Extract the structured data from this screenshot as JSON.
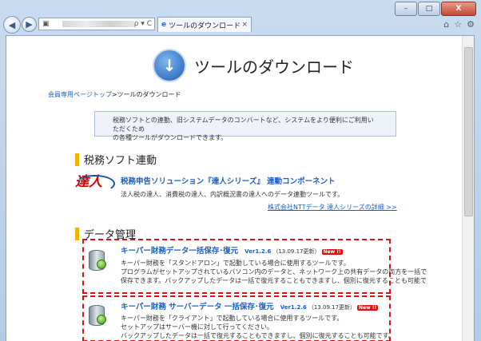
{
  "browser": {
    "tab_title": "ツールのダウンロード",
    "tab_close": "×",
    "address_icons": "ρ ▾ C",
    "window_buttons": [
      "–",
      "□",
      "X"
    ],
    "tool_icons": [
      "⌂",
      "☆",
      "⚙"
    ]
  },
  "page": {
    "title": "ツールのダウンロード",
    "breadcrumb_link": "会員専用ページトップ",
    "breadcrumb_sep": ">",
    "breadcrumb_current": "ツールのダウンロード",
    "info_line1": "税務ソフトとの連動、旧システムデータのコンバートなど、システムをより便利にご利用いただくため",
    "info_line2": "の各種ツールがダウンロードできます。"
  },
  "sections": {
    "tax_link": {
      "heading": "税務ソフト連動",
      "item_title": "税務申告ソリューション『達人シリーズ』 連動コンポーネント",
      "item_desc": "法人税の達人、消費税の達人、内訳概況書の達人へのデータ連動ツールです。",
      "more_link": "株式会社NTTデータ 達人シリーズの詳細 >>",
      "logo_text": "達人"
    },
    "data_mgmt": {
      "heading": "データ管理",
      "items": [
        {
          "title": "キーパー財務データ一括保存･復元",
          "version": "Ver1.2.6",
          "updated": "（13.09.17更新）",
          "badge": "New !!",
          "lines": [
            "キーパー財務を「スタンドアロン」で起動している場合に使用するツールです。",
            "プログラムがセットアップされているパソコン内のデータと、ネットワーク上の共有データの両方を一括で",
            "保存できます。バックアップしたデータは一括で復元することもできますし、個別に復元することも可能で"
          ]
        },
        {
          "title": "キーパー財務 サーバーデータ 一括保存･復元",
          "version": "Ver1.2.6",
          "updated": "（13.09.17更新）",
          "badge": "New !!",
          "lines": [
            "キーパー財務を「クライアント」で起動している場合に使用するツールです。",
            "セットアップはサーバー機に対して行ってください。",
            "バックアップしたデータは一括で復元することもできますし、個別に復元することも可能です。"
          ]
        }
      ]
    }
  }
}
